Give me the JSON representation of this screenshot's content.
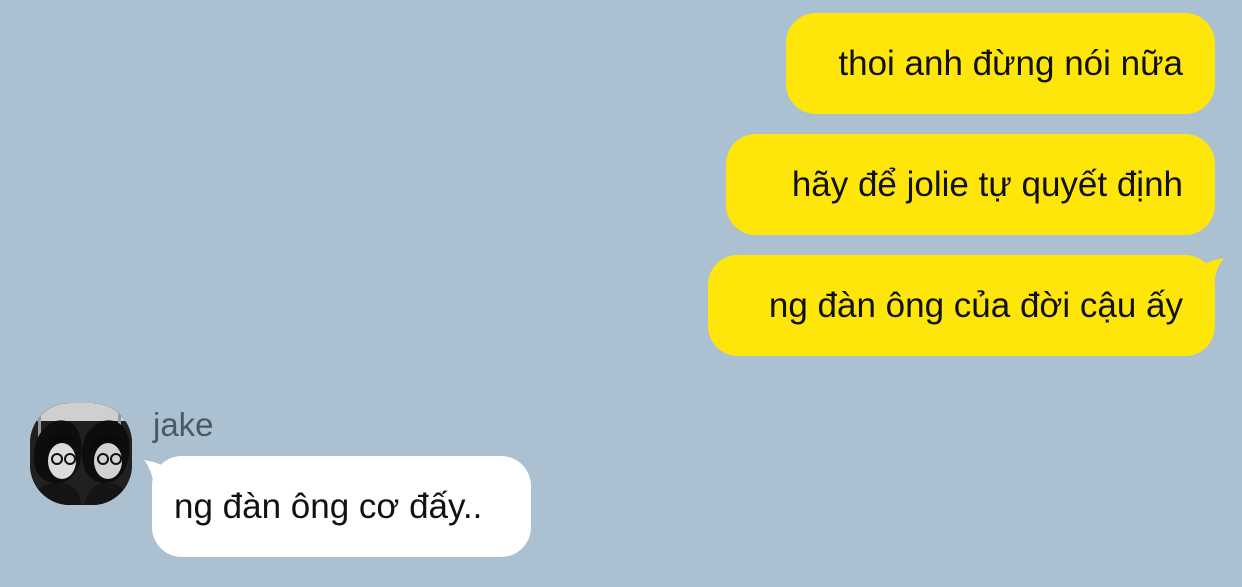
{
  "conversation": {
    "outgoing": [
      {
        "text": "thoi anh đừng nói nữa"
      },
      {
        "text": "hãy để jolie tự quyết định"
      },
      {
        "text": "ng đàn ông của đời cậu ấy"
      }
    ],
    "incoming": {
      "sender": "jake",
      "messages": [
        {
          "text": "ng đàn ông cơ đấy.."
        }
      ]
    }
  },
  "colors": {
    "background": "#abc1d1",
    "outgoing_bubble": "#fee60a",
    "incoming_bubble": "#ffffff",
    "sender_name": "#4e5862"
  }
}
